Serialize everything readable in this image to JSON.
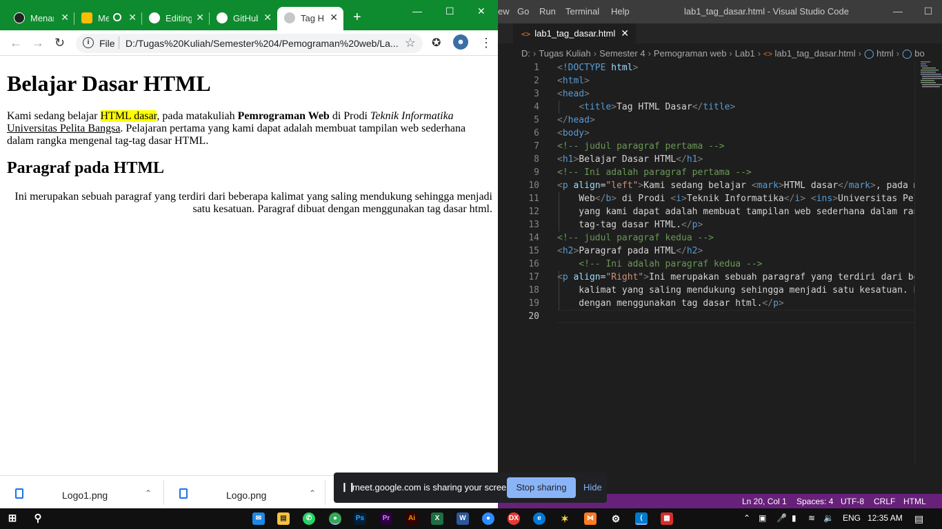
{
  "chrome": {
    "tabs": [
      {
        "label": "Menar",
        "icon": "claude-icon"
      },
      {
        "label": "Me",
        "icon": "meet-icon"
      },
      {
        "label": "Editing",
        "icon": "github-icon"
      },
      {
        "label": "GitHub",
        "icon": "github-icon"
      },
      {
        "label": "Tag HT",
        "icon": "globe-icon"
      }
    ],
    "new_tab": "+",
    "address": {
      "scheme": "File",
      "url": "D:/Tugas%20Kuliah/Semester%204/Pemograman%20web/La..."
    },
    "page": {
      "h1": "Belajar Dasar HTML",
      "p1_a": "Kami sedang belajar ",
      "p1_mark": "HTML dasar",
      "p1_b": ", pada matakuliah ",
      "p1_bold": "Pemrograman Web",
      "p1_c": " di Prodi ",
      "p1_italic": "Teknik Informatika",
      "p1_d": " ",
      "p1_ins": "Universitas Pelita Bangsa",
      "p1_e": ". Pelajaran pertama yang kami dapat adalah membuat tampilan web sederhana dalam rangka mengenal tag-tag dasar HTML.",
      "h2": "Paragraf pada HTML",
      "p2": "Ini merupakan sebuah paragraf yang terdiri dari beberapa kalimat yang saling mendukung sehingga menjadi satu kesatuan. Paragraf dibuat dengan menggunakan tag dasar html."
    },
    "downloads": [
      "Logo1.png",
      "Logo.png"
    ]
  },
  "meet": {
    "message": "meet.google.com is sharing your screen.",
    "stop": "Stop sharing",
    "hide": "Hide"
  },
  "vscode": {
    "menu": [
      "ew",
      "Go",
      "Run",
      "Terminal",
      "Help"
    ],
    "title": "lab1_tag_dasar.html - Visual Studio Code",
    "tab": "lab1_tag_dasar.html",
    "breadcrumb": [
      "D:",
      "Tugas Kuliah",
      "Semester 4",
      "Pemograman web",
      "Lab1",
      "lab1_tag_dasar.html",
      "html",
      "bo"
    ],
    "line_numbers": [
      "1",
      "2",
      "3",
      "4",
      "5",
      "6",
      "7",
      "8",
      "9",
      "10",
      "11",
      "12",
      "13",
      "14",
      "15",
      "16",
      "17",
      "18",
      "19",
      "20"
    ],
    "status": {
      "position": "Ln 20, Col 1",
      "spaces": "Spaces: 4",
      "encoding": "UTF-8",
      "eol": "CRLF",
      "language": "HTML"
    }
  },
  "taskbar": {
    "lang": "ENG",
    "time": "12:35 AM"
  }
}
